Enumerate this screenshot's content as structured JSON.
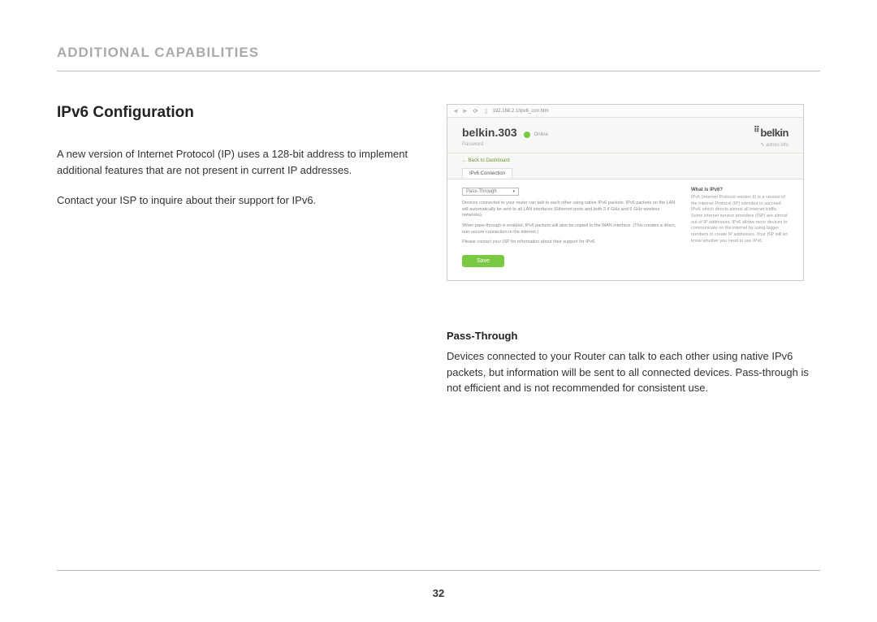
{
  "section_title": "ADDITIONAL CAPABILITIES",
  "heading": "IPv6 Configuration",
  "paragraph1": "A new version of Internet Protocol (IP) uses a 128-bit address to implement additional features that are not present in current IP addresses.",
  "paragraph2": "Contact your ISP to inquire about their support for IPv6.",
  "sub_heading": "Pass-Through",
  "sub_paragraph": "Devices connected to your Router can talk to each other using native IPv6 packets, but information will be sent to all connected devices. Pass-through is not efficient and is not recommended for consistent use.",
  "page_number": "32",
  "screenshot": {
    "url": "192.168.2.1/ipv6_con.htm",
    "router_name": "belkin.303",
    "status": "Online",
    "brand": "belkin",
    "password_label": "Password",
    "back_link": "← Back to Dashboard",
    "tab": "IPv6 Connection",
    "select_value": "Pass-Through",
    "p1": "Devices connected to your router can talk to each other using native IPv6 packets. IPv6 packets on the LAN will automatically be sent to all LAN interfaces (Ethernet ports and both 2.4 GHz and 5 GHz wireless networks).",
    "p2": "When pass-through is enabled, IPv6 packets will also be copied to the WAN interface. (This creates a direct, non-secure connection to the internet.)",
    "p3": "Please contact your ISP for information about their support for IPv6.",
    "save": "Save",
    "aside_h": "What Is IPv6?",
    "aside_p": "IPv6 (Internet Protocol version 6) is a version of the Internet Protocol (IP) intended to succeed IPv4, which directs almost all internet traffic. Some internet service providers (ISP) are almost out of IP addresses. IPv6 allows more devices to communicate on the internet by using bigger numbers to create IP addresses. Your ISP will let know whether you need to use IPv6."
  }
}
